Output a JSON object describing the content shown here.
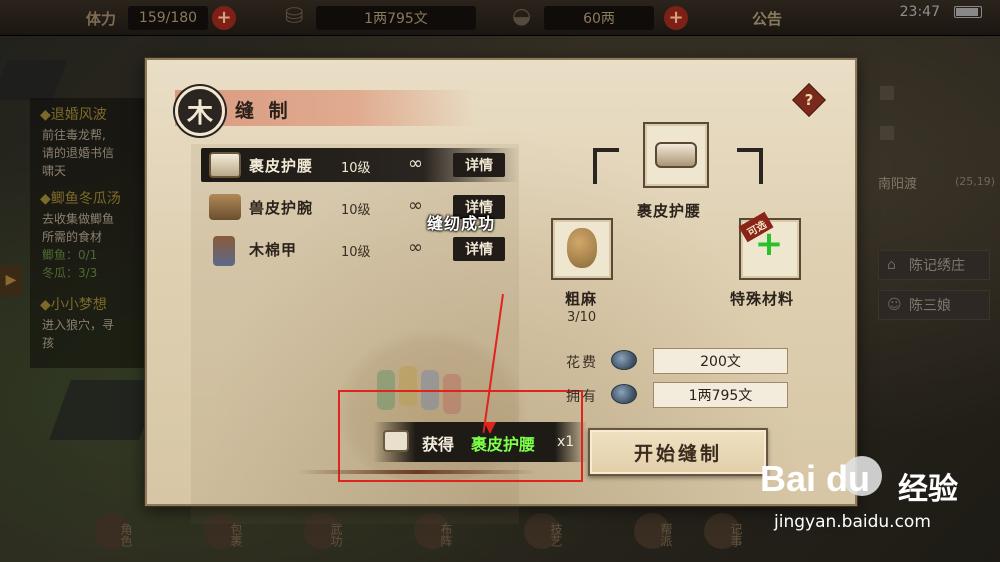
{
  "topbar": {
    "stamina_label": "体力",
    "stamina_value": "159/180",
    "money_value": "1两795文",
    "gold_value": "60两",
    "notice_label": "公告",
    "time": "23:47"
  },
  "quests": {
    "q1_title": "◆退婚风波",
    "q1_lines": [
      "前往毒龙帮,",
      "请的退婚书信",
      "啸天"
    ],
    "q2_title": "◆鲫鱼冬瓜汤",
    "q2_lines": [
      "去收集做鲫鱼",
      "所需的食材",
      "鲫鱼：0/1",
      "冬瓜：3/3"
    ],
    "q3_title": "◆小小梦想",
    "q3_lines": [
      "进入狼穴，寻",
      "孩"
    ]
  },
  "right_panel": {
    "location": "南阳渡",
    "coord": "(25,19)",
    "npc1": "陈记绣庄",
    "npc2": "陈三娘"
  },
  "bottom_menu": [
    "角色",
    "包裹",
    "武功",
    "布阵",
    "技艺",
    "帮派",
    "记事"
  ],
  "dialog": {
    "title": "缝 制",
    "help": "?",
    "recipes": [
      {
        "name": "裹皮护腰",
        "level": "10级",
        "count": "∞",
        "detail": "详情"
      },
      {
        "name": "兽皮护腕",
        "level": "10级",
        "count": "∞",
        "detail": "详情"
      },
      {
        "name": "木棉甲",
        "level": "10级",
        "count": "∞",
        "detail": "详情"
      }
    ],
    "toast": "缝纫成功",
    "gain": {
      "label": "获得",
      "item": "裹皮护腰",
      "qty": "x1"
    },
    "target": {
      "name": "裹皮护腰"
    },
    "material1": {
      "name": "粗麻",
      "count": "3/10"
    },
    "material2": {
      "name": "特殊材料",
      "badge": "可选"
    },
    "cost_label": "花费",
    "cost_value": "200文",
    "owned_label": "拥有",
    "owned_value": "1两795文",
    "start_button": "开始缝制"
  },
  "watermark": {
    "logo": "Bai du",
    "cn": "经验",
    "url": "jingyan.baidu.com"
  },
  "colors": {
    "accent_red": "#e0231c",
    "success_green": "#7dff4a",
    "parchment": "#e2d4b6"
  }
}
